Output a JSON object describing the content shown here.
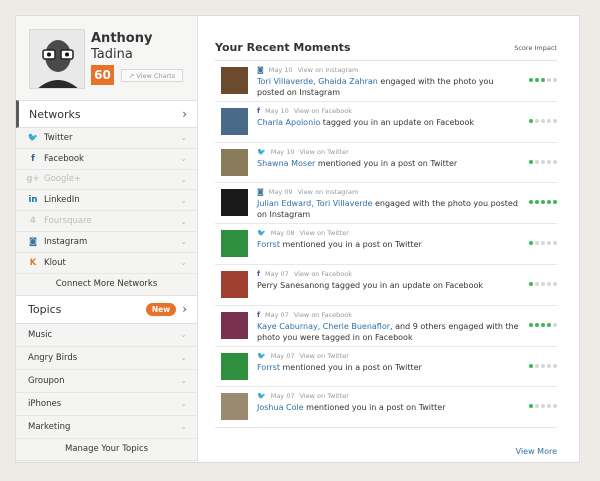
{
  "profile": {
    "first_name": "Anthony",
    "last_name": "Tadina",
    "score": "60",
    "view_charts": "View Charts"
  },
  "networks": {
    "title": "Networks",
    "items": [
      {
        "label": "Twitter",
        "icon": "twitter-icon",
        "glyph": "🐦",
        "color": "#2fa8e0",
        "connected": true
      },
      {
        "label": "Facebook",
        "icon": "facebook-icon",
        "glyph": "f",
        "color": "#3b5998",
        "connected": true
      },
      {
        "label": "Google+",
        "icon": "google-plus-icon",
        "glyph": "g+",
        "color": "#c8c8c8",
        "connected": false
      },
      {
        "label": "LinkedIn",
        "icon": "linkedin-icon",
        "glyph": "in",
        "color": "#0e76a8",
        "connected": true
      },
      {
        "label": "Foursquare",
        "icon": "foursquare-icon",
        "glyph": "4",
        "color": "#c8c8c8",
        "connected": false
      },
      {
        "label": "Instagram",
        "icon": "instagram-icon",
        "glyph": "◙",
        "color": "#3f729b",
        "connected": true
      },
      {
        "label": "Klout",
        "icon": "klout-icon",
        "glyph": "K",
        "color": "#e7722a",
        "connected": true
      }
    ],
    "connect_more": "Connect More Networks"
  },
  "topics": {
    "title": "Topics",
    "badge": "New",
    "items": [
      "Music",
      "Angry Birds",
      "Groupon",
      "iPhones",
      "Marketing"
    ],
    "manage": "Manage Your Topics"
  },
  "moments": {
    "title": "Your Recent Moments",
    "score_impact": "Score Impact",
    "view_more": "View More",
    "items": [
      {
        "source": "instagram",
        "date": "May 10",
        "via": "View on Instagram",
        "names": "Tori Villaverde, Ghaida Zahran",
        "text": " engaged with the photo you posted on Instagram",
        "score": 3,
        "thumb": "#6b4a2e"
      },
      {
        "source": "facebook",
        "date": "May 10",
        "via": "View on Facebook",
        "names": "Charla Apolonio",
        "text": " tagged you in an update on Facebook",
        "score": 1,
        "thumb": "#4a6a8a"
      },
      {
        "source": "twitter",
        "date": "May 10",
        "via": "View on Twitter",
        "names": "Shawna Moser",
        "text": " mentioned you in a post on Twitter",
        "score": 1,
        "thumb": "#8a7a5c"
      },
      {
        "source": "instagram",
        "date": "May 09",
        "via": "View on Instagram",
        "names": "Julian Edward, Tori Villaverde",
        "text": " engaged with the photo you posted on Instagram",
        "score": 5,
        "thumb": "#1a1a1a"
      },
      {
        "source": "twitter",
        "date": "May 08",
        "via": "View on Twitter",
        "names": "Forrst",
        "text": " mentioned you in a post on Twitter",
        "score": 1,
        "thumb": "#2e8f3e"
      },
      {
        "source": "facebook",
        "date": "May 07",
        "via": "View on Facebook",
        "names": "",
        "text": "Perry Sanesanong tagged you in an update on Facebook",
        "score": 1,
        "thumb": "#a04030"
      },
      {
        "source": "facebook",
        "date": "May 07",
        "via": "View on Facebook",
        "names": "Kaye Caburnay, Cherie Buenaflor",
        "text": ", and 9 others engaged with the photo you were tagged in on Facebook",
        "score": 4,
        "thumb": "#7a3050"
      },
      {
        "source": "twitter",
        "date": "May 07",
        "via": "View on Twitter",
        "names": "Forrst",
        "text": " mentioned you in a post on Twitter",
        "score": 1,
        "thumb": "#2e8f3e"
      },
      {
        "source": "twitter",
        "date": "May 07",
        "via": "View on Twitter",
        "names": "Joshua Cole",
        "text": " mentioned you in a post on Twitter",
        "score": 1,
        "thumb": "#9a8a70"
      }
    ]
  }
}
